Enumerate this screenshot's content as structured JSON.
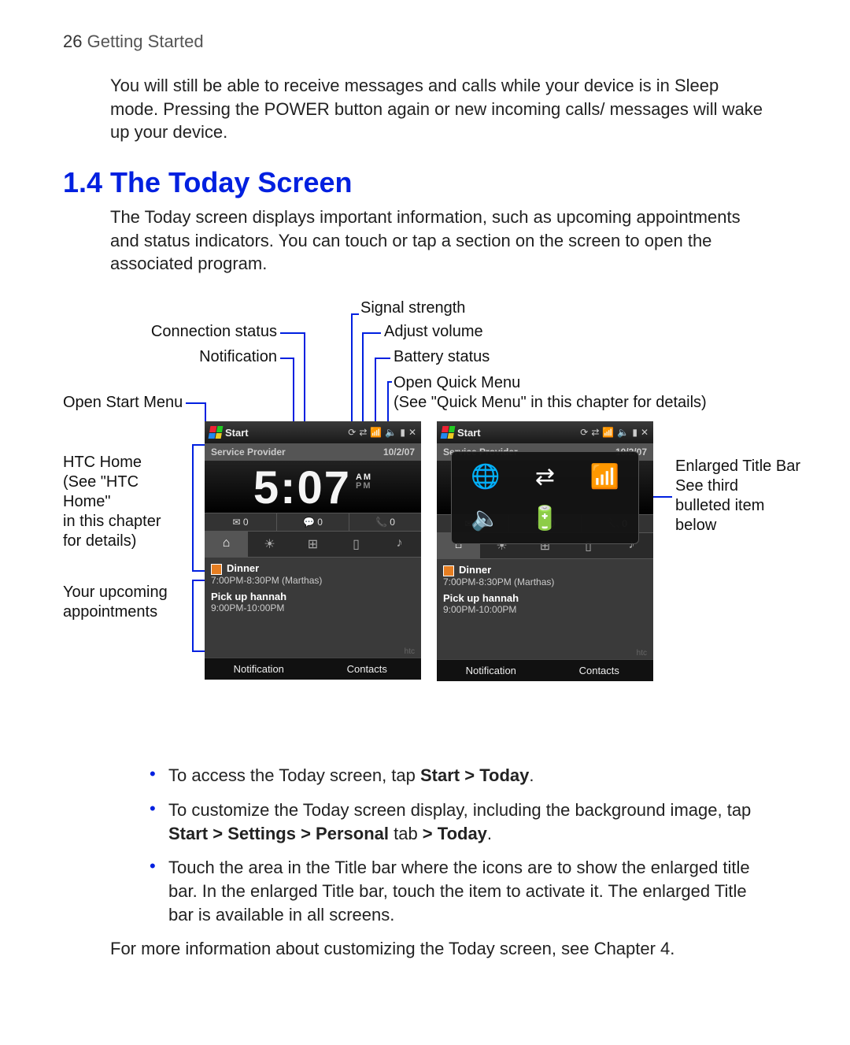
{
  "page": {
    "number": "26",
    "chapter": "Getting Started"
  },
  "intro_para": "You will still be able to receive messages and calls while your device is in Sleep mode. Pressing the POWER button again or new incoming calls/ messages will wake up your device.",
  "section_heading": "1.4 The Today Screen",
  "section_para": "The Today screen displays important information, such as upcoming appointments and status indicators. You can touch or tap a section on the screen to open the associated program.",
  "callouts": {
    "signal_strength": "Signal strength",
    "connection_status": "Connection status",
    "adjust_volume": "Adjust volume",
    "notification": "Notification",
    "battery_status": "Battery status",
    "open_quick_menu_l1": "Open Quick Menu",
    "open_quick_menu_l2": "(See \"Quick Menu\" in this chapter for details)",
    "open_start_menu": "Open Start Menu",
    "htc_home_l1": "HTC Home",
    "htc_home_l2": "(See \"HTC Home\"",
    "htc_home_l3": "in this chapter",
    "htc_home_l4": "for details)",
    "upcoming_l1": "Your upcoming",
    "upcoming_l2": "appointments",
    "enlarged_l1": "Enlarged Title Bar",
    "enlarged_l2": "See third",
    "enlarged_l3": "bulleted item",
    "enlarged_l4": "below"
  },
  "phone": {
    "start": "Start",
    "provider": "Service Provider",
    "date": "10/2/07",
    "time": "5:07",
    "am": "AM",
    "pm": "PM",
    "count_mail": "0",
    "count_msg": "0",
    "count_call": "0",
    "tab_home": "⌂",
    "tab_weather": "☀",
    "tab_apps": "⊞",
    "tab_phone": "▯",
    "tab_music": "♪",
    "appt1_title": "Dinner",
    "appt1_sub": "7:00PM-8:30PM (Marthas)",
    "appt2_title": "Pick up hannah",
    "appt2_sub": "9:00PM-10:00PM",
    "htc": "htc",
    "soft_left": "Notification",
    "soft_right": "Contacts",
    "overlay_icons": [
      "🌐",
      "⇄",
      "📶",
      "🔈",
      "🔋",
      "✕"
    ]
  },
  "bullets": {
    "b1_pre": "To access the Today screen, tap ",
    "b1_bold": "Start > Today",
    "b1_post": ".",
    "b2_pre": "To customize the Today screen display, including the background image, tap ",
    "b2_bold": "Start > Settings > Personal",
    "b2_mid": " tab ",
    "b2_bold2": "> Today",
    "b2_post": ".",
    "b3": "Touch the area in the Title bar where the icons are to show the enlarged title bar. In the enlarged Title bar, touch the item to activate it. The enlarged Title bar is available in all screens."
  },
  "closing": "For more information about customizing the Today screen, see Chapter 4."
}
